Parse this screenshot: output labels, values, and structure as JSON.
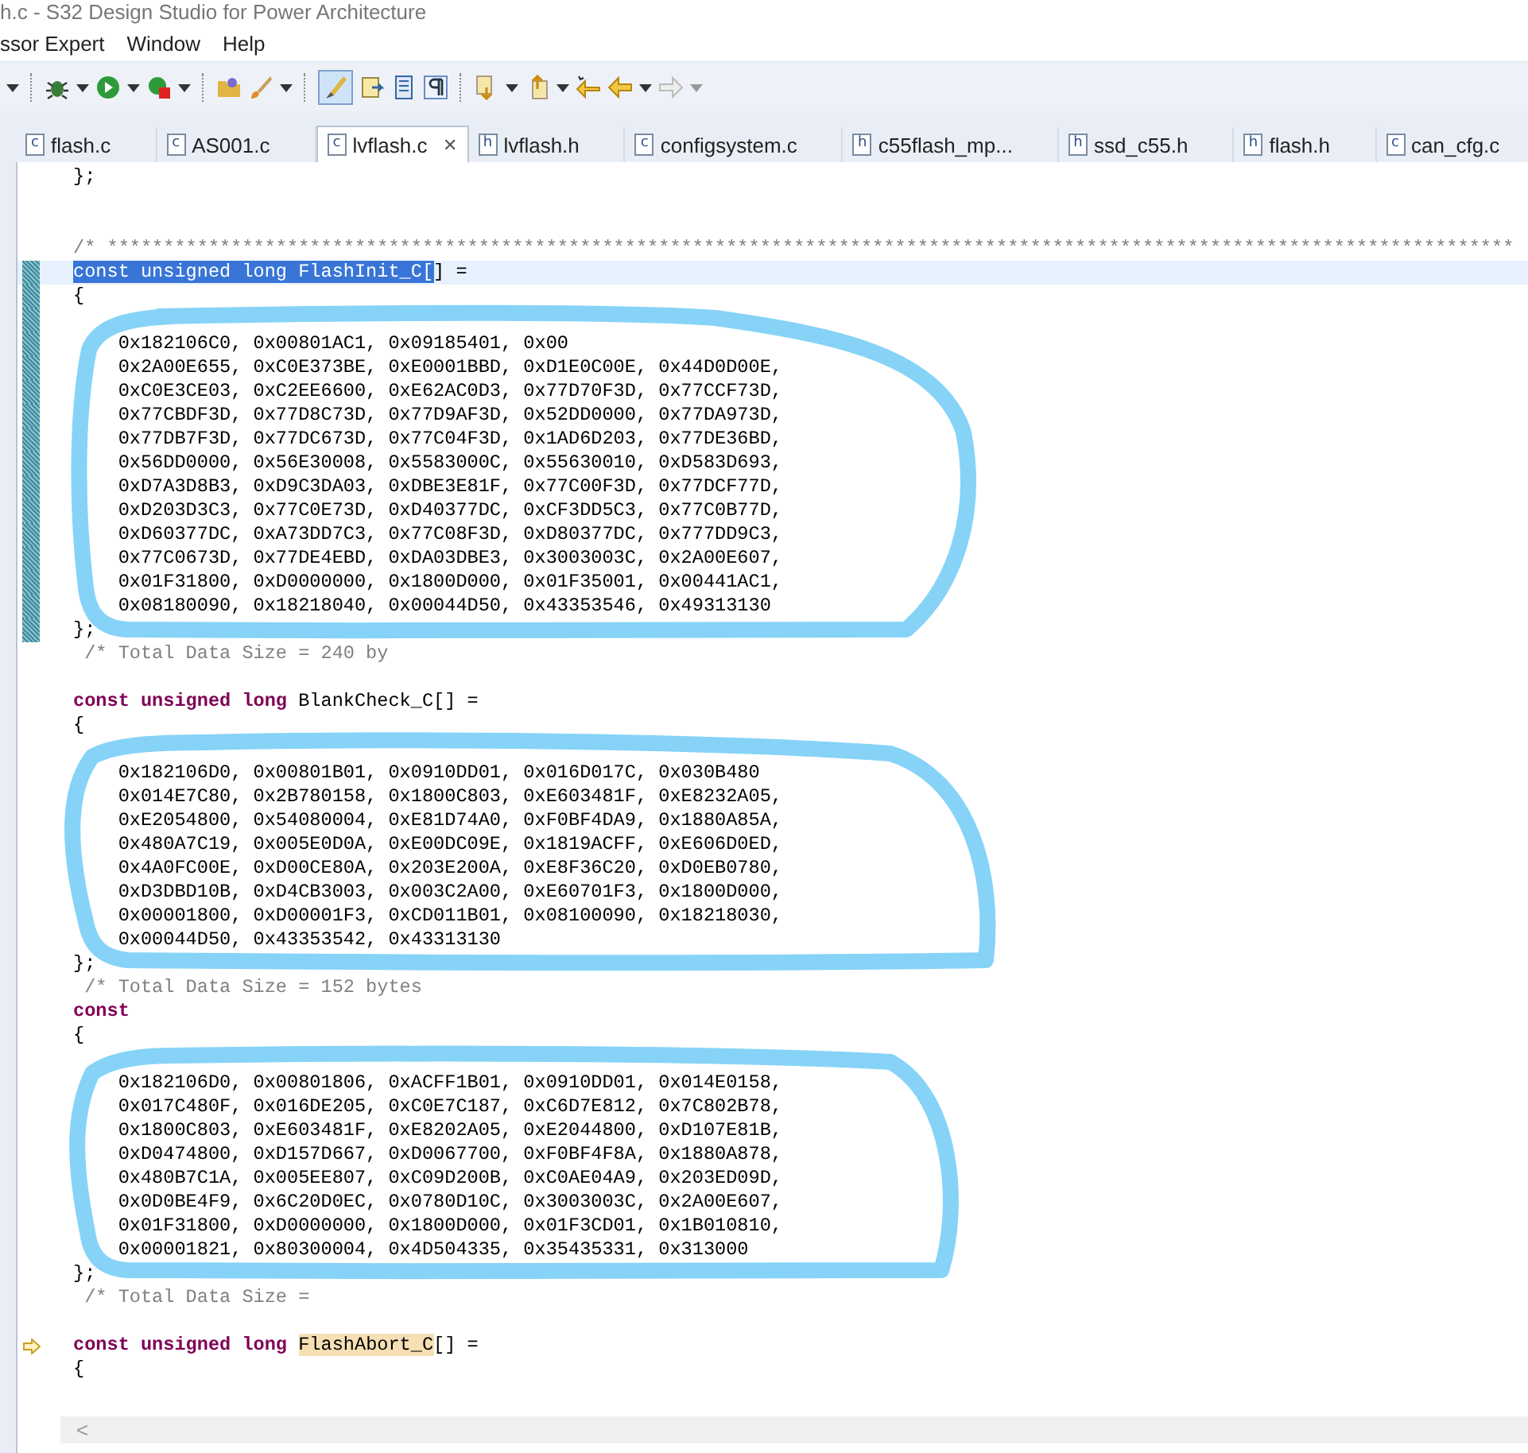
{
  "window": {
    "title": "h.c - S32 Design Studio for Power Architecture"
  },
  "menu": [
    "ssor Expert",
    "Window",
    "Help"
  ],
  "toolbar": {
    "mark_occurrences": {
      "selected": true
    }
  },
  "tabs": [
    {
      "icon": "c",
      "label": "flash.c",
      "selected": false
    },
    {
      "icon": "c",
      "label": "AS001.c",
      "selected": false
    },
    {
      "icon": "c",
      "label": "lvflash.c",
      "selected": true,
      "close": "✕"
    },
    {
      "icon": "h",
      "label": "lvflash.h",
      "selected": false
    },
    {
      "icon": "c",
      "label": "configsystem.c",
      "selected": false
    },
    {
      "icon": "h",
      "label": "c55flash_mp...",
      "selected": false
    },
    {
      "icon": "h",
      "label": "ssd_c55.h",
      "selected": false
    },
    {
      "icon": "h",
      "label": "flash.h",
      "selected": false
    },
    {
      "icon": "c",
      "label": "can_cfg.c",
      "selected": false
    }
  ],
  "editor": {
    "lines": [
      {
        "current": false,
        "segments": [
          {
            "kind": "plain",
            "text": "};"
          }
        ]
      },
      {
        "current": false
      },
      {
        "current": false
      },
      {
        "current": false,
        "segments": [
          {
            "kind": "comment",
            "text": "/* *****************************************************************************************************************************"
          }
        ]
      },
      {
        "current": true,
        "kind": "range",
        "segments": [
          {
            "kind": "selection",
            "text": "const unsigned long FlashInit_C["
          },
          {
            "kind": "plain",
            "text": "] ="
          }
        ]
      },
      {
        "current": false,
        "kind": "range",
        "segments": [
          {
            "kind": "plain",
            "text": "{"
          }
        ]
      },
      {
        "current": false,
        "kind": "range"
      },
      {
        "current": false,
        "kind": "range",
        "segments": [
          {
            "kind": "plain",
            "text": "    0x182106C0, 0x00801AC1, 0x09185401, 0x00"
          }
        ]
      },
      {
        "current": false,
        "kind": "range",
        "segments": [
          {
            "kind": "plain",
            "text": "    0x2A00E655, 0xC0E373BE, 0xE0001BBD, 0xD1E0C00E, 0x44D0D00E,"
          }
        ]
      },
      {
        "current": false,
        "kind": "range",
        "segments": [
          {
            "kind": "plain",
            "text": "    0xC0E3CE03, 0xC2EE6600, 0xE62AC0D3, 0x77D70F3D, 0x77CCF73D,"
          }
        ]
      },
      {
        "current": false,
        "kind": "range",
        "segments": [
          {
            "kind": "plain",
            "text": "    0x77CBDF3D, 0x77D8C73D, 0x77D9AF3D, 0x52DD0000, 0x77DA973D,"
          }
        ]
      },
      {
        "current": false,
        "kind": "range",
        "segments": [
          {
            "kind": "plain",
            "text": "    0x77DB7F3D, 0x77DC673D, 0x77C04F3D, 0x1AD6D203, 0x77DE36BD,"
          }
        ]
      },
      {
        "current": false,
        "kind": "range",
        "segments": [
          {
            "kind": "plain",
            "text": "    0x56DD0000, 0x56E30008, 0x5583000C, 0x55630010, 0xD583D693,"
          }
        ]
      },
      {
        "current": false,
        "kind": "range",
        "segments": [
          {
            "kind": "plain",
            "text": "    0xD7A3D8B3, 0xD9C3DA03, 0xDBE3E81F, 0x77C00F3D, 0x77DCF77D,"
          }
        ]
      },
      {
        "current": false,
        "kind": "range",
        "segments": [
          {
            "kind": "plain",
            "text": "    0xD203D3C3, 0x77C0E73D, 0xD40377DC, 0xCF3DD5C3, 0x77C0B77D,"
          }
        ]
      },
      {
        "current": false,
        "kind": "range",
        "segments": [
          {
            "kind": "plain",
            "text": "    0xD60377DC, 0xA73DD7C3, 0x77C08F3D, 0xD80377DC, 0x777DD9C3,"
          }
        ]
      },
      {
        "current": false,
        "kind": "range",
        "segments": [
          {
            "kind": "plain",
            "text": "    0x77C0673D, 0x77DE4EBD, 0xDA03DBE3, 0x3003003C, 0x2A00E607,"
          }
        ]
      },
      {
        "current": false,
        "kind": "range",
        "segments": [
          {
            "kind": "plain",
            "text": "    0x01F31800, 0xD0000000, 0x1800D000, 0x01F35001, 0x00441AC1,"
          }
        ]
      },
      {
        "current": false,
        "kind": "range",
        "segments": [
          {
            "kind": "plain",
            "text": "    0x08180090, 0x18218040, 0x00044D50, 0x43353546, 0x49313130"
          }
        ]
      },
      {
        "current": false,
        "kind": "range",
        "segments": [
          {
            "kind": "plain",
            "text": "};"
          }
        ]
      },
      {
        "current": false,
        "segments": [
          {
            "kind": "comment",
            "text": " /* Total Data Size = 240 by"
          }
        ]
      },
      {
        "current": false
      },
      {
        "current": false,
        "segments": [
          {
            "kind": "keyword",
            "text": "const unsigned long"
          },
          {
            "kind": "plain",
            "text": " BlankCheck_C[] ="
          }
        ]
      },
      {
        "current": false,
        "segments": [
          {
            "kind": "plain",
            "text": "{"
          }
        ]
      },
      {
        "current": false
      },
      {
        "current": false,
        "segments": [
          {
            "kind": "plain",
            "text": "    0x182106D0, 0x00801B01, 0x0910DD01, 0x016D017C, 0x030B480"
          }
        ]
      },
      {
        "current": false,
        "segments": [
          {
            "kind": "plain",
            "text": "    0x014E7C80, 0x2B780158, 0x1800C803, 0xE603481F, 0xE8232A05,"
          }
        ]
      },
      {
        "current": false,
        "segments": [
          {
            "kind": "plain",
            "text": "    0xE2054800, 0x54080004, 0xE81D74A0, 0xF0BF4DA9, 0x1880A85A,"
          }
        ]
      },
      {
        "current": false,
        "segments": [
          {
            "kind": "plain",
            "text": "    0x480A7C19, 0x005E0D0A, 0xE00DC09E, 0x1819ACFF, 0xE606D0ED,"
          }
        ]
      },
      {
        "current": false,
        "segments": [
          {
            "kind": "plain",
            "text": "    0x4A0FC00E, 0xD00CE80A, 0x203E200A, 0xE8F36C20, 0xD0EB0780,"
          }
        ]
      },
      {
        "current": false,
        "segments": [
          {
            "kind": "plain",
            "text": "    0xD3DBD10B, 0xD4CB3003, 0x003C2A00, 0xE60701F3, 0x1800D000,"
          }
        ]
      },
      {
        "current": false,
        "segments": [
          {
            "kind": "plain",
            "text": "    0x00001800, 0xD00001F3, 0xCD011B01, 0x08100090, 0x18218030,"
          }
        ]
      },
      {
        "current": false,
        "segments": [
          {
            "kind": "plain",
            "text": "    0x00044D50, 0x43353542, 0x43313130"
          }
        ]
      },
      {
        "current": false,
        "segments": [
          {
            "kind": "plain",
            "text": "};"
          }
        ]
      },
      {
        "current": false,
        "segments": [
          {
            "kind": "comment",
            "text": " /* Total Data Size = 152 bytes"
          }
        ]
      },
      {
        "current": false,
        "segments": [
          {
            "kind": "keyword",
            "text": "const"
          }
        ]
      },
      {
        "current": false,
        "segments": [
          {
            "kind": "plain",
            "text": "{"
          }
        ]
      },
      {
        "current": false
      },
      {
        "current": false,
        "segments": [
          {
            "kind": "plain",
            "text": "    0x182106D0, 0x00801806, 0xACFF1B01, 0x0910DD01, 0x014E0158,"
          }
        ]
      },
      {
        "current": false,
        "segments": [
          {
            "kind": "plain",
            "text": "    0x017C480F, 0x016DE205, 0xC0E7C187, 0xC6D7E812, 0x7C802B78,"
          }
        ]
      },
      {
        "current": false,
        "segments": [
          {
            "kind": "plain",
            "text": "    0x1800C803, 0xE603481F, 0xE8202A05, 0xE2044800, 0xD107E81B,"
          }
        ]
      },
      {
        "current": false,
        "segments": [
          {
            "kind": "plain",
            "text": "    0xD0474800, 0xD157D667, 0xD0067700, 0xF0BF4F8A, 0x1880A878,"
          }
        ]
      },
      {
        "current": false,
        "segments": [
          {
            "kind": "plain",
            "text": "    0x480B7C1A, 0x005EE807, 0xC09D200B, 0xC0AE04A9, 0x203ED09D,"
          }
        ]
      },
      {
        "current": false,
        "segments": [
          {
            "kind": "plain",
            "text": "    0x0D0BE4F9, 0x6C20D0EC, 0x0780D10C, 0x3003003C, 0x2A00E607,"
          }
        ]
      },
      {
        "current": false,
        "segments": [
          {
            "kind": "plain",
            "text": "    0x01F31800, 0xD0000000, 0x1800D000, 0x01F3CD01, 0x1B010810,"
          }
        ]
      },
      {
        "current": false,
        "segments": [
          {
            "kind": "plain",
            "text": "    0x00001821, 0x80300004, 0x4D504335, 0x35435331, 0x313000"
          }
        ]
      },
      {
        "current": false,
        "segments": [
          {
            "kind": "plain",
            "text": "};"
          }
        ]
      },
      {
        "current": false,
        "segments": [
          {
            "kind": "comment",
            "text": " /* Total Data Size ="
          }
        ]
      },
      {
        "current": false
      },
      {
        "current": false,
        "kind": "arrow",
        "segments": [
          {
            "kind": "keyword",
            "text": "const unsigned long "
          },
          {
            "kind": "occurrence",
            "text": "FlashAbort_C"
          },
          {
            "kind": "plain",
            "text": "[] ="
          }
        ]
      },
      {
        "current": false,
        "segments": [
          {
            "kind": "plain",
            "text": "{"
          }
        ]
      }
    ]
  },
  "scrollbar": {
    "left_arrow": "<"
  }
}
